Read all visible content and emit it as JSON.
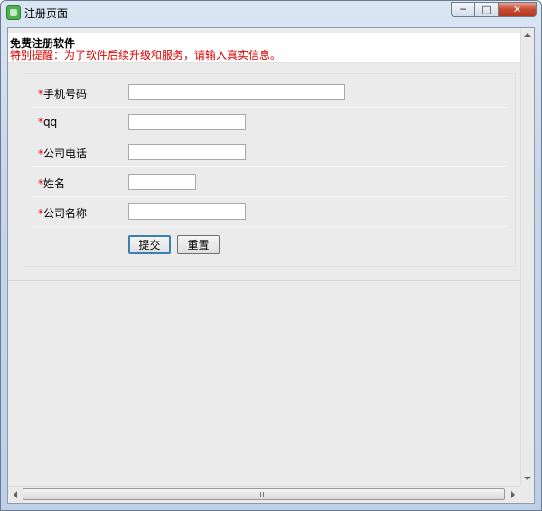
{
  "window": {
    "title": "注册页面",
    "minimize_label": "─",
    "maximize_label": "□",
    "close_label": "✕"
  },
  "header": {
    "title": "免费注册软件",
    "notice": "特别提醒：为了软件后续升级和服务，请输入真实信息。"
  },
  "form": {
    "required_mark": "*",
    "fields": [
      {
        "label": "手机号码",
        "value": ""
      },
      {
        "label": "qq",
        "value": ""
      },
      {
        "label": "公司电话",
        "value": ""
      },
      {
        "label": "姓名",
        "value": ""
      },
      {
        "label": "公司名称",
        "value": ""
      }
    ],
    "submit_label": "提交",
    "reset_label": "重置"
  },
  "colors": {
    "required": "#e00000",
    "notice": "#e00000",
    "panel_bg": "#ebebeb"
  },
  "icons": {
    "app": "app-icon",
    "scroll_grip": "grip-icon"
  }
}
